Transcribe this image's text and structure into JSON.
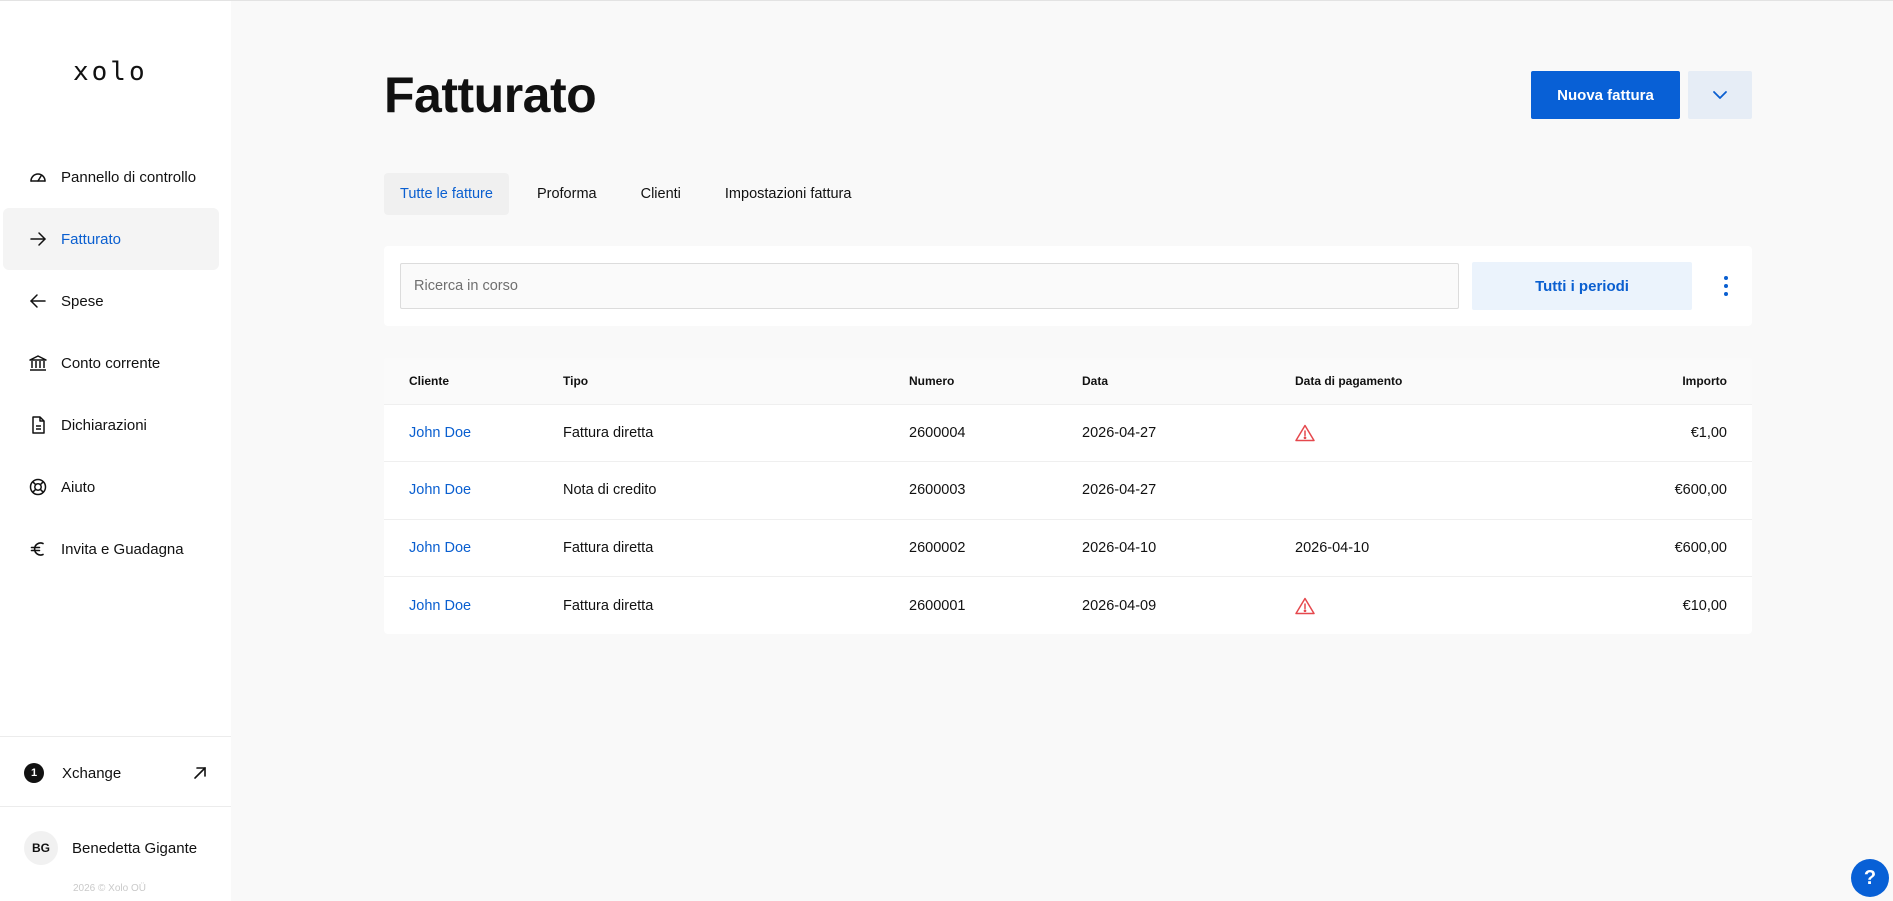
{
  "brand": {
    "logo_text": "xolo"
  },
  "sidebar": {
    "items": [
      {
        "label": "Pannello di controllo",
        "icon": "dashboard-gauge-icon",
        "active": false
      },
      {
        "label": "Fatturato",
        "icon": "arrow-right-icon",
        "active": true
      },
      {
        "label": "Spese",
        "icon": "arrow-left-icon",
        "active": false
      },
      {
        "label": "Conto corrente",
        "icon": "bank-icon",
        "active": false
      },
      {
        "label": "Dichiarazioni",
        "icon": "document-icon",
        "active": false
      },
      {
        "label": "Aiuto",
        "icon": "lifebuoy-icon",
        "active": false
      },
      {
        "label": "Invita e Guadagna",
        "icon": "euro-icon",
        "active": false
      }
    ],
    "xchange": {
      "badge": "1",
      "label": "Xchange",
      "icon": "external-arrow-icon"
    },
    "user": {
      "initials": "BG",
      "name": "Benedetta Gigante"
    },
    "copyright": "2026 © Xolo OÜ"
  },
  "header": {
    "title": "Fatturato",
    "primary_button": "Nuova fattura",
    "dropdown_icon": "chevron-down-icon"
  },
  "tabs": [
    {
      "label": "Tutte le fatture",
      "active": true
    },
    {
      "label": "Proforma",
      "active": false
    },
    {
      "label": "Clienti",
      "active": false
    },
    {
      "label": "Impostazioni fattura",
      "active": false
    }
  ],
  "search": {
    "placeholder": "Ricerca in corso",
    "value": "",
    "period_button": "Tutti i periodi",
    "more_icon": "kebab-menu-icon"
  },
  "table": {
    "columns": [
      "Cliente",
      "Tipo",
      "Numero",
      "Data",
      "Data di pagamento",
      "Importo"
    ],
    "rows": [
      {
        "cliente": "John Doe",
        "tipo": "Fattura diretta",
        "numero": "2600004",
        "data": "2026-04-27",
        "pagamento": "",
        "pagamento_warning": true,
        "importo": "€1,00"
      },
      {
        "cliente": "John Doe",
        "tipo": "Nota di credito",
        "numero": "2600003",
        "data": "2026-04-27",
        "pagamento": "",
        "pagamento_warning": false,
        "importo": "€600,00"
      },
      {
        "cliente": "John Doe",
        "tipo": "Fattura diretta",
        "numero": "2600002",
        "data": "2026-04-10",
        "pagamento": "2026-04-10",
        "pagamento_warning": false,
        "importo": "€600,00"
      },
      {
        "cliente": "John Doe",
        "tipo": "Fattura diretta",
        "numero": "2600001",
        "data": "2026-04-09",
        "pagamento": "",
        "pagamento_warning": true,
        "importo": "€10,00"
      }
    ]
  },
  "help": {
    "label": "?"
  },
  "colors": {
    "accent": "#0860d6",
    "link": "#0a5fd0",
    "warning": "#e5484d"
  }
}
